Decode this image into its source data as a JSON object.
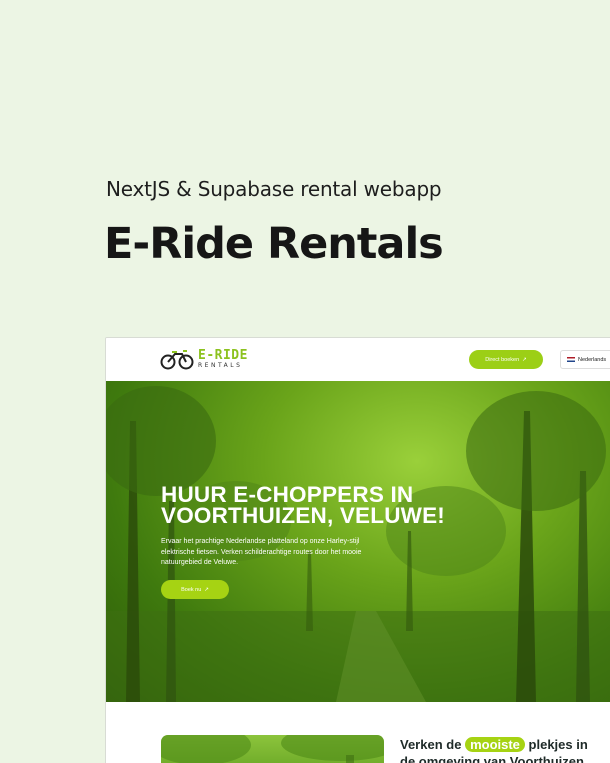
{
  "header": {
    "subtitle": "NextJS & Supabase rental webapp",
    "title": "E-Ride Rentals"
  },
  "site": {
    "logo": {
      "main": "E-RIDE",
      "sub": "RENTALS"
    },
    "nav": {
      "book_label": "Direct boeken",
      "language_label": "Nederlands"
    },
    "hero": {
      "heading_line1": "HUUR E-CHOPPERS IN",
      "heading_line2": "VOORTHUIZEN, VELUWE!",
      "text": "Ervaar het prachtige Nederlandse platteland op onze Harley-stijl elektrische fietsen. Verken schilderachtige routes door het mooie natuurgebied de Veluwe.",
      "cta_label": "Boek nu"
    },
    "section": {
      "heading_before": "Verken de",
      "heading_highlight": "mooiste",
      "heading_after": "plekjes in",
      "heading_line2": "de omgeving van Voorthuizen"
    }
  },
  "colors": {
    "page_bg": "#ecf5e4",
    "accent": "#a6d313",
    "dark_text": "#161616"
  },
  "icons": [
    "bike-logo-icon",
    "arrow-up-right-icon",
    "dutch-flag-icon"
  ]
}
